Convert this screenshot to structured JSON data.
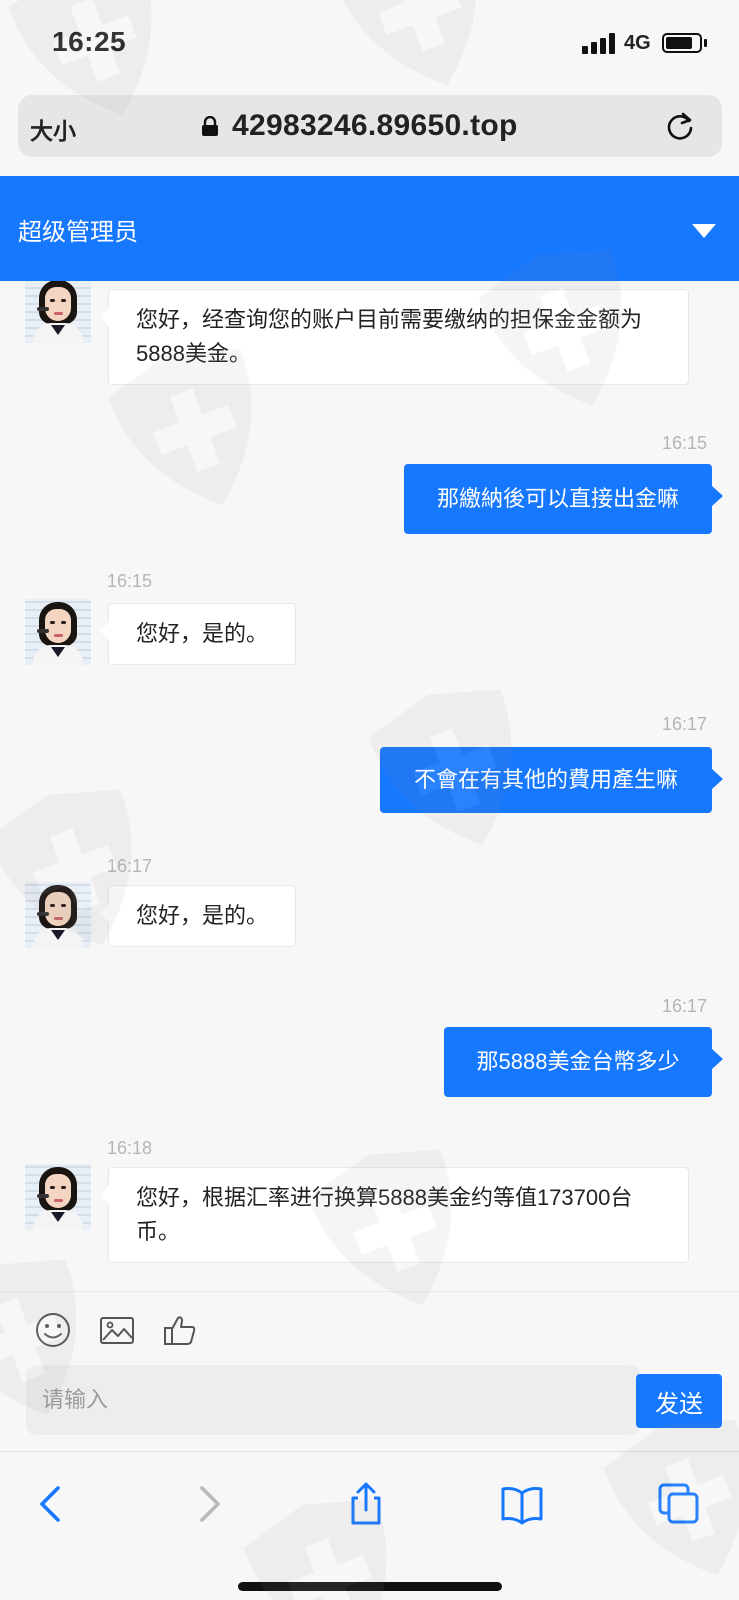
{
  "status_bar": {
    "time": "16:25",
    "network": "4G"
  },
  "browser": {
    "text_size_label": "大小",
    "url": "42983246.89650.top"
  },
  "chat_header": {
    "title": "超级管理员"
  },
  "messages": [
    {
      "sender": "agent",
      "time": "",
      "text": "您好，经查询您的账户目前需要缴纳的担保金金额为5888美金。"
    },
    {
      "sender": "user",
      "time": "16:15",
      "text": "那繳納後可以直接出金嘛"
    },
    {
      "sender": "agent",
      "time": "16:15",
      "text": "您好，是的。"
    },
    {
      "sender": "user",
      "time": "16:17",
      "text": "不會在有其他的費用產生嘛"
    },
    {
      "sender": "agent",
      "time": "16:17",
      "text": "您好，是的。"
    },
    {
      "sender": "user",
      "time": "16:17",
      "text": "那5888美金台幣多少"
    },
    {
      "sender": "agent",
      "time": "16:18",
      "text": "您好，根据汇率进行换算5888美金约等值173700台币。"
    }
  ],
  "composer": {
    "toolbar_icons": [
      "emoji-icon",
      "image-icon",
      "thumbs-up-icon"
    ],
    "placeholder": "请输入",
    "send_label": "发送"
  },
  "browser_toolbar": {
    "icons": [
      "back-icon",
      "forward-icon",
      "share-icon",
      "bookmarks-icon",
      "tabs-icon"
    ]
  },
  "colors": {
    "accent": "#1677ff",
    "background": "#f7f7f7",
    "bubble_in": "#ffffff",
    "timestamp": "#b5b5b5"
  }
}
